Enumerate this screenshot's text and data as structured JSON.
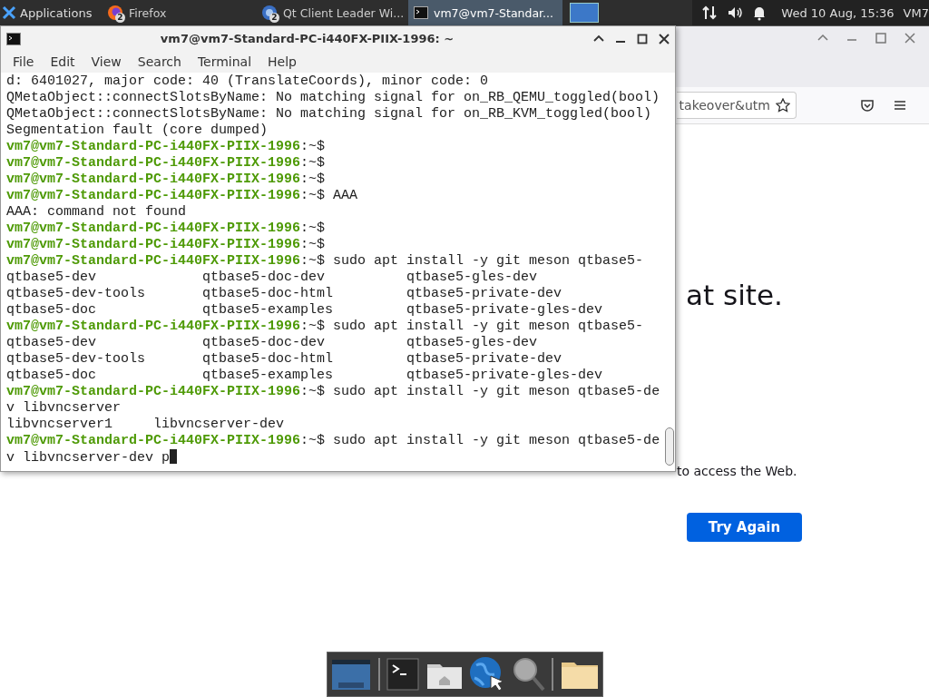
{
  "panel": {
    "applications": "Applications",
    "tasks": [
      {
        "kind": "firefox",
        "label": "Firefox",
        "badge": "2",
        "selected": false
      },
      {
        "kind": "qt",
        "label": "Qt Client Leader Wi...",
        "badge": "2",
        "selected": false
      },
      {
        "kind": "terminal",
        "label": "vm7@vm7-Standar...",
        "selected": true
      }
    ],
    "clock": "Wed 10 Aug, 15:36",
    "user": "VM7"
  },
  "firefox": {
    "url_fragment": "takeover&utm",
    "heading_fragment": "at site.",
    "message_fragment": "to access the Web.",
    "button": "Try Again"
  },
  "terminal": {
    "title": "vm7@vm7-Standard-PC-i440FX-PIIX-1996: ~",
    "menu": [
      "File",
      "Edit",
      "View",
      "Search",
      "Terminal",
      "Help"
    ],
    "cursor": true,
    "lines": [
      {
        "text": "d: 6401027, major code: 40 (TranslateCoords), minor code: 0"
      },
      {
        "text": "QMetaObject::connectSlotsByName: No matching signal for on_RB_QEMU_toggled(bool)"
      },
      {
        "text": "QMetaObject::connectSlotsByName: No matching signal for on_RB_KVM_toggled(bool)"
      },
      {
        "text": "Segmentation fault (core dumped)"
      },
      {
        "prompt": "vm7@vm7-Standard-PC-i440FX-PIIX-1996",
        "text": ":~$"
      },
      {
        "prompt": "vm7@vm7-Standard-PC-i440FX-PIIX-1996",
        "text": ":~$"
      },
      {
        "prompt": "vm7@vm7-Standard-PC-i440FX-PIIX-1996",
        "text": ":~$"
      },
      {
        "prompt": "vm7@vm7-Standard-PC-i440FX-PIIX-1996",
        "text": ":~$ AAA"
      },
      {
        "text": "AAA: command not found"
      },
      {
        "prompt": "vm7@vm7-Standard-PC-i440FX-PIIX-1996",
        "text": ":~$"
      },
      {
        "prompt": "vm7@vm7-Standard-PC-i440FX-PIIX-1996",
        "text": ":~$"
      },
      {
        "prompt": "vm7@vm7-Standard-PC-i440FX-PIIX-1996",
        "text": ":~$ sudo apt install -y git meson qtbase5-"
      },
      {
        "text": "qtbase5-dev             qtbase5-doc-dev          qtbase5-gles-dev"
      },
      {
        "text": "qtbase5-dev-tools       qtbase5-doc-html         qtbase5-private-dev"
      },
      {
        "text": "qtbase5-doc             qtbase5-examples         qtbase5-private-gles-dev"
      },
      {
        "prompt": "vm7@vm7-Standard-PC-i440FX-PIIX-1996",
        "text": ":~$ sudo apt install -y git meson qtbase5-"
      },
      {
        "text": "qtbase5-dev             qtbase5-doc-dev          qtbase5-gles-dev"
      },
      {
        "text": "qtbase5-dev-tools       qtbase5-doc-html         qtbase5-private-dev"
      },
      {
        "text": "qtbase5-doc             qtbase5-examples         qtbase5-private-gles-dev"
      },
      {
        "prompt": "vm7@vm7-Standard-PC-i440FX-PIIX-1996",
        "text": ":~$ sudo apt install -y git meson qtbase5-de"
      },
      {
        "text": "v libvncserver"
      },
      {
        "text": "libvncserver1     libvncserver-dev"
      },
      {
        "prompt": "vm7@vm7-Standard-PC-i440FX-PIIX-1996",
        "text": ":~$ sudo apt install -y git meson qtbase5-de"
      },
      {
        "text": "v libvncserver-dev p"
      }
    ]
  },
  "dock": {
    "items": [
      {
        "kind": "desktop"
      },
      {
        "kind": "separator"
      },
      {
        "kind": "terminal"
      },
      {
        "kind": "home"
      },
      {
        "kind": "globe"
      },
      {
        "kind": "search"
      },
      {
        "kind": "separator"
      },
      {
        "kind": "folder"
      }
    ]
  }
}
